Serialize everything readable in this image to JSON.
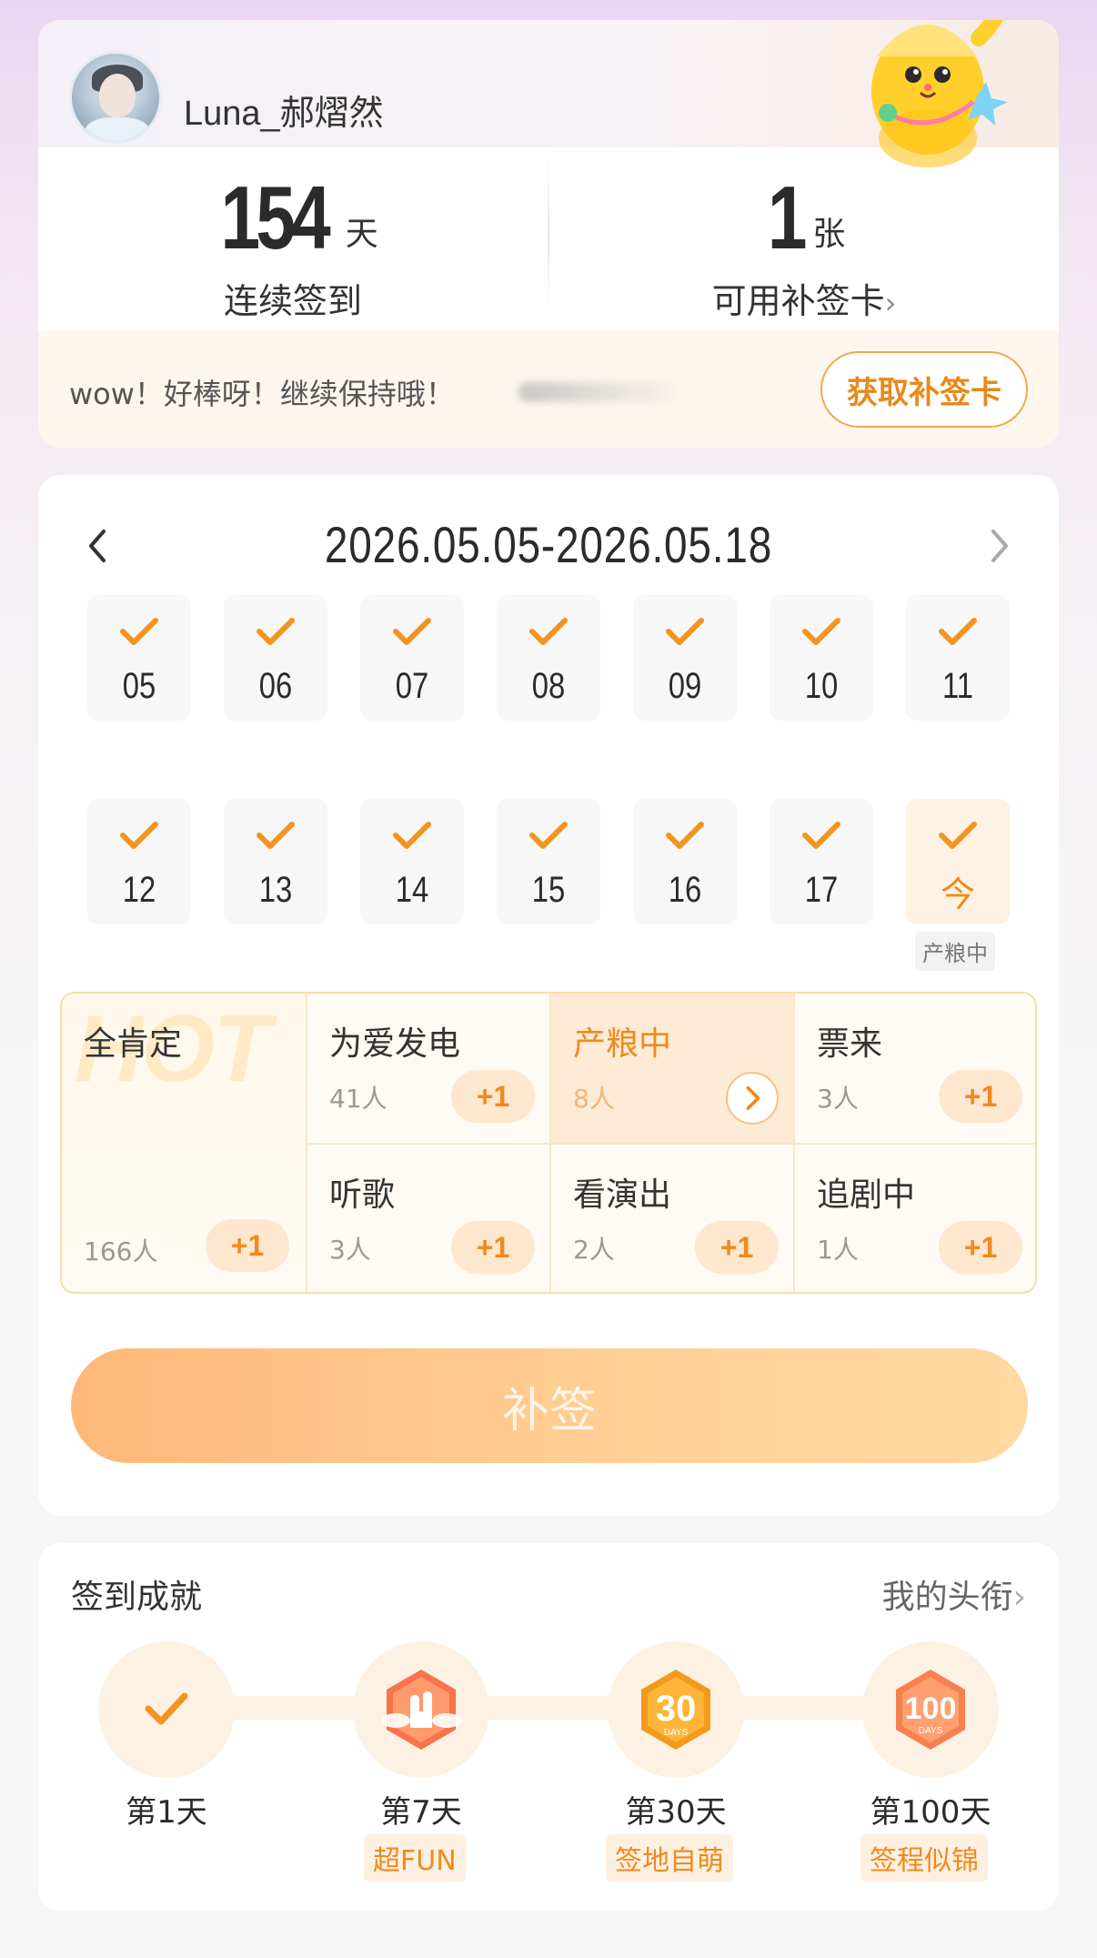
{
  "user": {
    "name": "Luna_郝熠然"
  },
  "stats": {
    "streak_value": "154",
    "streak_unit": "天",
    "streak_label": "连续签到",
    "cards_value": "1",
    "cards_unit": "张",
    "cards_label": "可用补签卡"
  },
  "encourage": {
    "text": "wow！好棒呀！继续保持哦！",
    "button": "获取补签卡"
  },
  "calendar": {
    "range": "2026.05.05-2026.05.18",
    "row1": [
      "05",
      "06",
      "07",
      "08",
      "09",
      "10",
      "11"
    ],
    "row2": [
      "12",
      "13",
      "14",
      "15",
      "16",
      "17"
    ],
    "today_label": "今",
    "today_tag": "产粮中"
  },
  "tags": {
    "featured": {
      "title": "全肯定",
      "count": "166人",
      "plus": "+1",
      "watermark": "HOT"
    },
    "items": [
      {
        "title": "为爱发电",
        "count": "41人",
        "plus": "+1"
      },
      {
        "title": "产粮中",
        "count": "8人",
        "selected": true
      },
      {
        "title": "票来",
        "count": "3人",
        "plus": "+1"
      },
      {
        "title": "听歌",
        "count": "3人",
        "plus": "+1"
      },
      {
        "title": "看演出",
        "count": "2人",
        "plus": "+1"
      },
      {
        "title": "追剧中",
        "count": "1人",
        "plus": "+1"
      }
    ]
  },
  "resign_button": "补签",
  "achievements": {
    "title": "签到成就",
    "link": "我的头衔",
    "milestones": [
      {
        "day": "第1天",
        "badge": ""
      },
      {
        "day": "第7天",
        "badge": "超FUN"
      },
      {
        "day": "第30天",
        "badge": "签地自萌"
      },
      {
        "day": "第100天",
        "badge": "签程似锦"
      }
    ]
  },
  "colors": {
    "accent": "#f08a1c",
    "check": "#f2941f"
  }
}
